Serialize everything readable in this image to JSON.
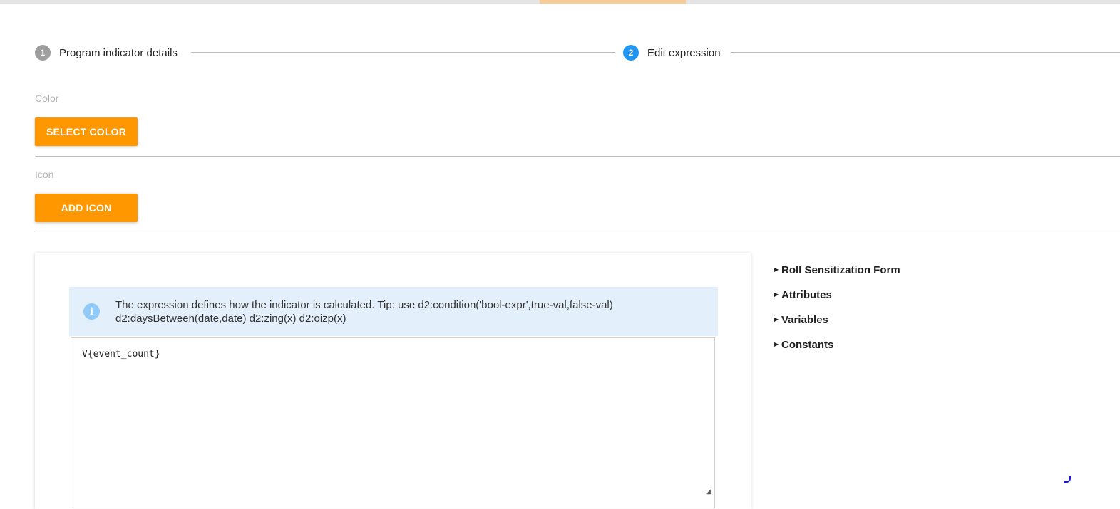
{
  "stepper": {
    "steps": [
      {
        "number": "1",
        "label": "Program indicator details",
        "state": "inactive"
      },
      {
        "number": "2",
        "label": "Edit expression",
        "state": "active"
      }
    ]
  },
  "color_field": {
    "label": "Color",
    "button_label": "SELECT COLOR"
  },
  "icon_field": {
    "label": "Icon",
    "button_label": "ADD ICON"
  },
  "expression": {
    "info_icon": "info-icon",
    "info_text": "The expression defines how the indicator is calculated. Tip: use d2:condition('bool-expr',true-val,false-val) d2:daysBetween(date,date) d2:zing(x) d2:oizp(x)",
    "value": "V{event_count}"
  },
  "side_tree": {
    "items": [
      {
        "label": "Roll Sensitization Form"
      },
      {
        "label": "Attributes"
      },
      {
        "label": "Variables"
      },
      {
        "label": "Constants"
      }
    ]
  },
  "colors": {
    "accent_orange": "#ff9800",
    "active_step": "#2196f3",
    "inactive_step": "#9e9e9e",
    "info_background": "#e3f0fb"
  }
}
